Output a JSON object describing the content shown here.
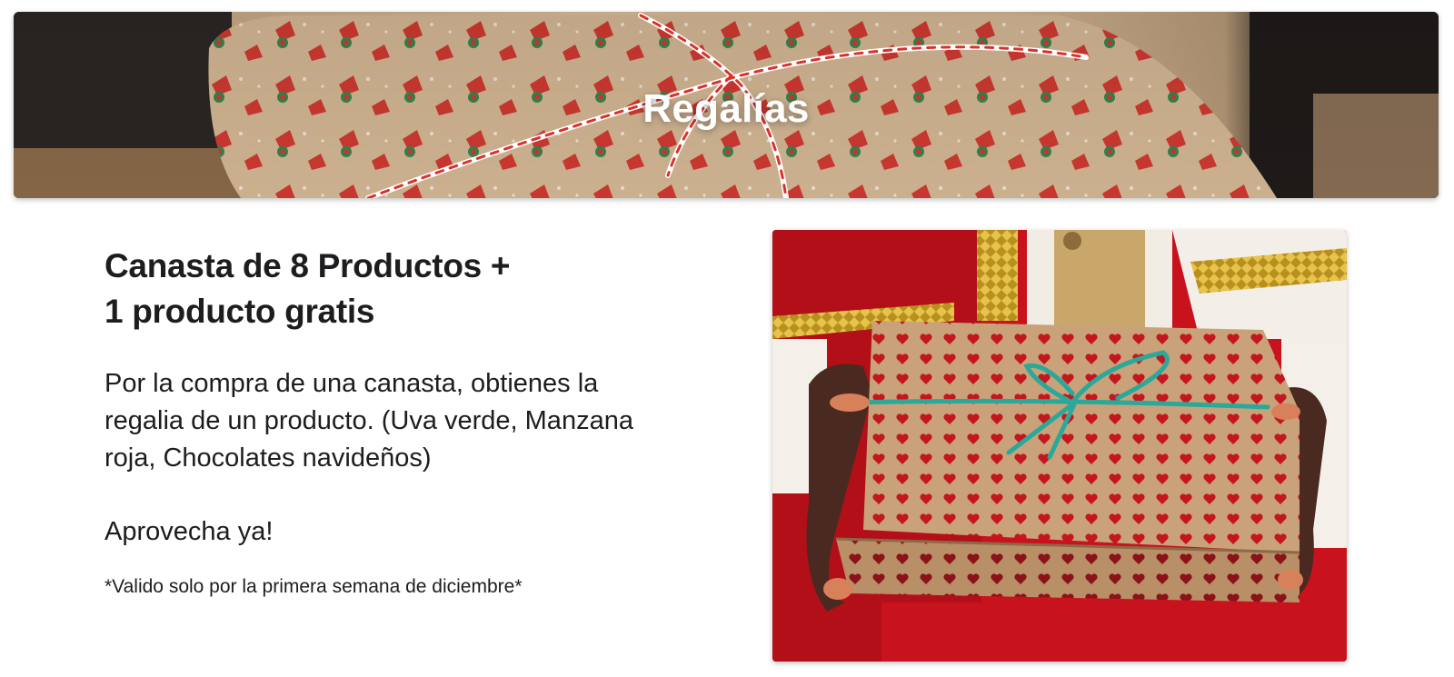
{
  "hero": {
    "title": "Regalías",
    "image": "wrapped-gift-santa-paper-image"
  },
  "offer": {
    "title_line1": "Canasta de 8 Productos +",
    "title_line2": "1 producto gratis",
    "description": "Por la compra de una canasta, obtienes la regalia de un producto. (Uva verde, Manzana roja, Chocolates navideños)",
    "cta": "Aprovecha ya!",
    "note": "*Valido solo por la primera semana de diciembre*"
  },
  "photo": {
    "image": "gift-box-hearts-held-by-hands-image"
  },
  "colors": {
    "text": "#1d1d1f",
    "red": "#c8121d",
    "kraft": "#c9a27a",
    "ribbon": "#2aa89a"
  }
}
